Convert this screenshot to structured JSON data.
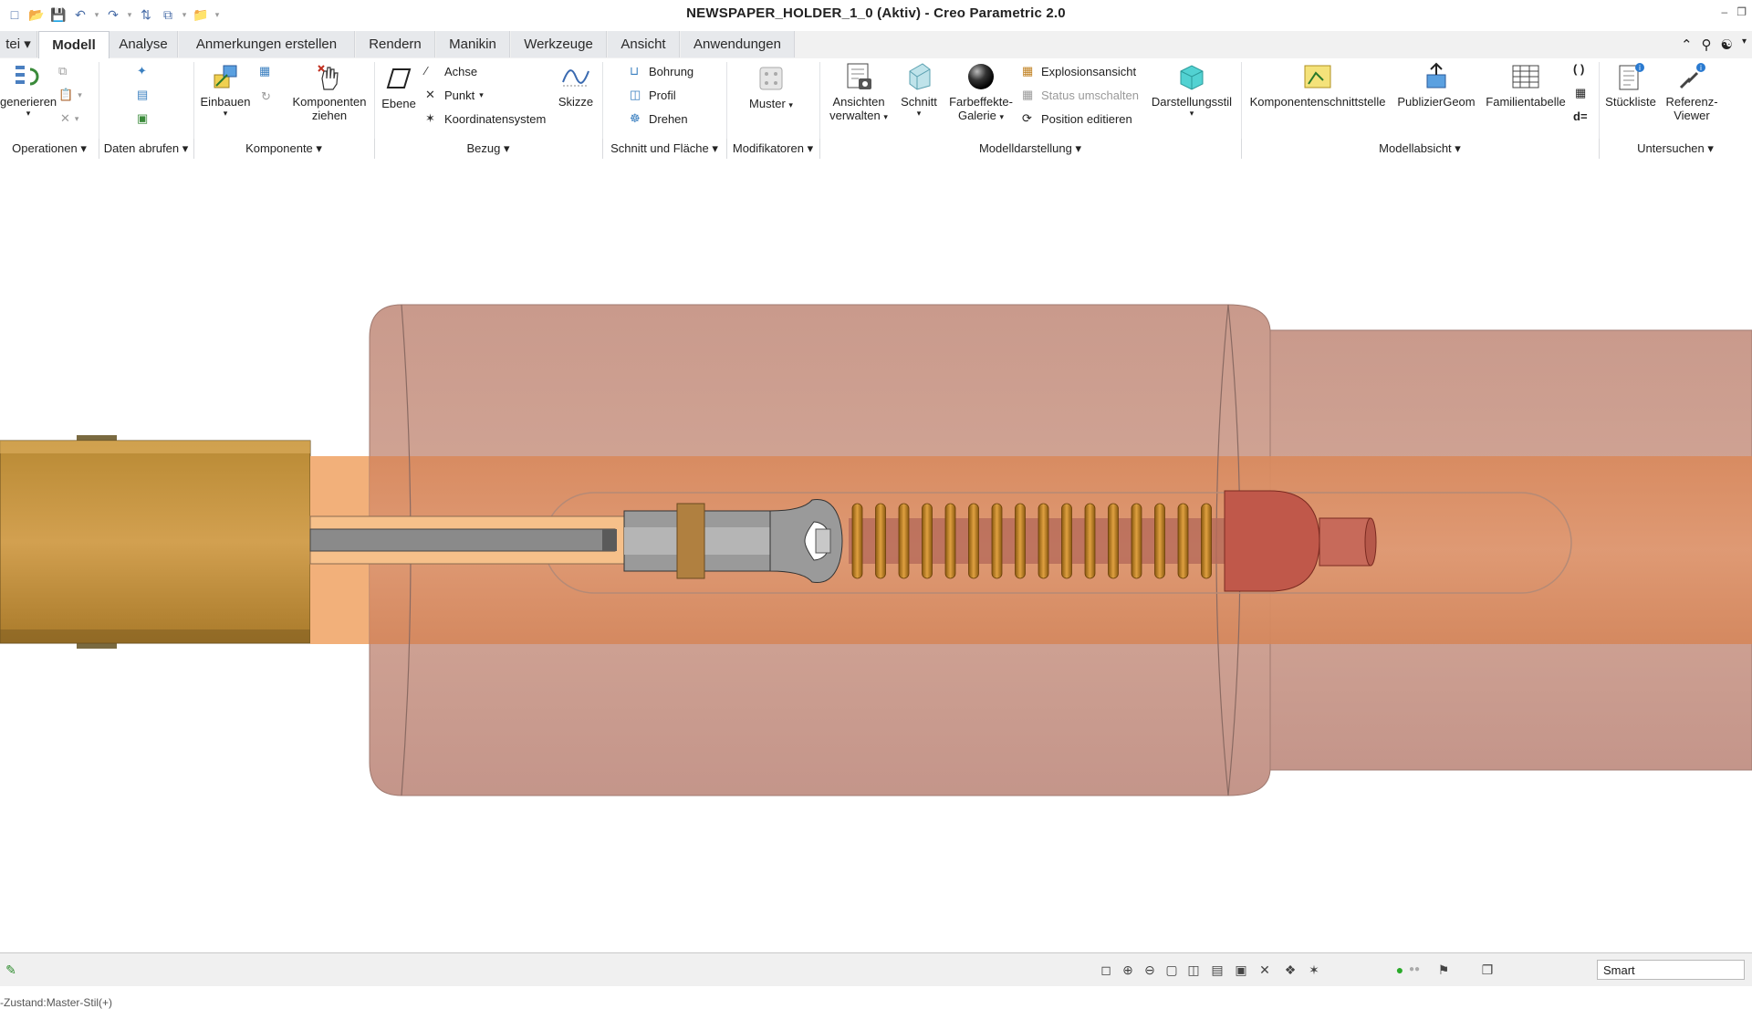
{
  "window": {
    "title": "NEWSPAPER_HOLDER_1_0 (Aktiv) - Creo Parametric 2.0"
  },
  "quick_access": [
    "new-icon",
    "open-icon",
    "save-icon",
    "undo-icon",
    "redo-icon",
    "regenerate-icon",
    "window-icon",
    "folder-icon",
    "customize-icon"
  ],
  "tabs": [
    "tei",
    "Modell",
    "Analyse",
    "Anmerkungen erstellen",
    "Rendern",
    "Manikin",
    "Werkzeuge",
    "Ansicht",
    "Anwendungen"
  ],
  "active_tab": "Modell",
  "ribbon": {
    "generieren": "generieren",
    "einbauen": "Einbauen",
    "komponenten_ziehen_1": "Komponenten",
    "komponenten_ziehen_2": "ziehen",
    "ebene": "Ebene",
    "achse": "Achse",
    "punkt": "Punkt",
    "koordinatensystem": "Koordinatensystem",
    "skizze": "Skizze",
    "bohrung": "Bohrung",
    "profil": "Profil",
    "drehen": "Drehen",
    "muster": "Muster",
    "ansichten_1": "Ansichten",
    "ansichten_2": "verwalten",
    "schnitt": "Schnitt",
    "farbeffekte_1": "Farbeffekte-",
    "farbeffekte_2": "Galerie",
    "explosionsansicht": "Explosionsansicht",
    "status_umschalten": "Status umschalten",
    "position_editieren": "Position editieren",
    "darstellungsstil": "Darstellungsstil",
    "komponentenschnittstelle": "Komponentenschnittstelle",
    "publiziergeom": "PublizierGeom",
    "familientabelle": "Familientabelle",
    "stueckliste": "Stückliste",
    "referenz_1": "Referenz-",
    "referenz_2": "Viewer"
  },
  "groups": [
    "Operationen",
    "Daten abrufen",
    "Komponente",
    "Bezug",
    "Schnitt und Fläche",
    "Modifikatoren",
    "Modelldarstellung",
    "Modellabsicht",
    "Untersuchen"
  ],
  "viewport": {
    "status_text": "-Zustand:Master-Stil(+)"
  },
  "statusbar": {
    "smart_filter": "Smart"
  },
  "colors": {
    "sleeve": "#c99a8c",
    "sleeve_core": "#d9895c",
    "spring": "#c98a2a",
    "cap": "#c0584a",
    "slider": "#c89642",
    "rod": "#8a8a8a"
  }
}
